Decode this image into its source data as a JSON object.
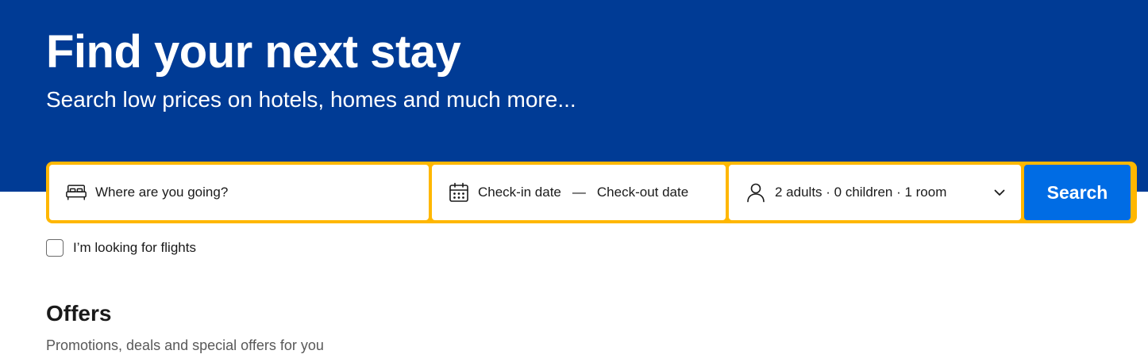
{
  "hero": {
    "title": "Find your next stay",
    "subtitle": "Search low prices on hotels, homes and much more..."
  },
  "search": {
    "destination_placeholder": "Where are you going?",
    "destination_value": "",
    "checkin_label": "Check-in date",
    "date_separator": "—",
    "checkout_label": "Check-out date",
    "guests_label": "2 adults · 0 children · 1 room",
    "search_button": "Search",
    "icons": {
      "destination": "bed-icon",
      "dates": "calendar-icon",
      "guests": "person-icon",
      "dropdown": "chevron-down-icon"
    }
  },
  "flights": {
    "label": "I’m looking for flights",
    "checked": false
  },
  "offers": {
    "title": "Offers",
    "subtitle": "Promotions, deals and special offers for you"
  },
  "colors": {
    "hero_bg": "#003b95",
    "search_border": "#ffb700",
    "search_button_bg": "#006ce4"
  }
}
